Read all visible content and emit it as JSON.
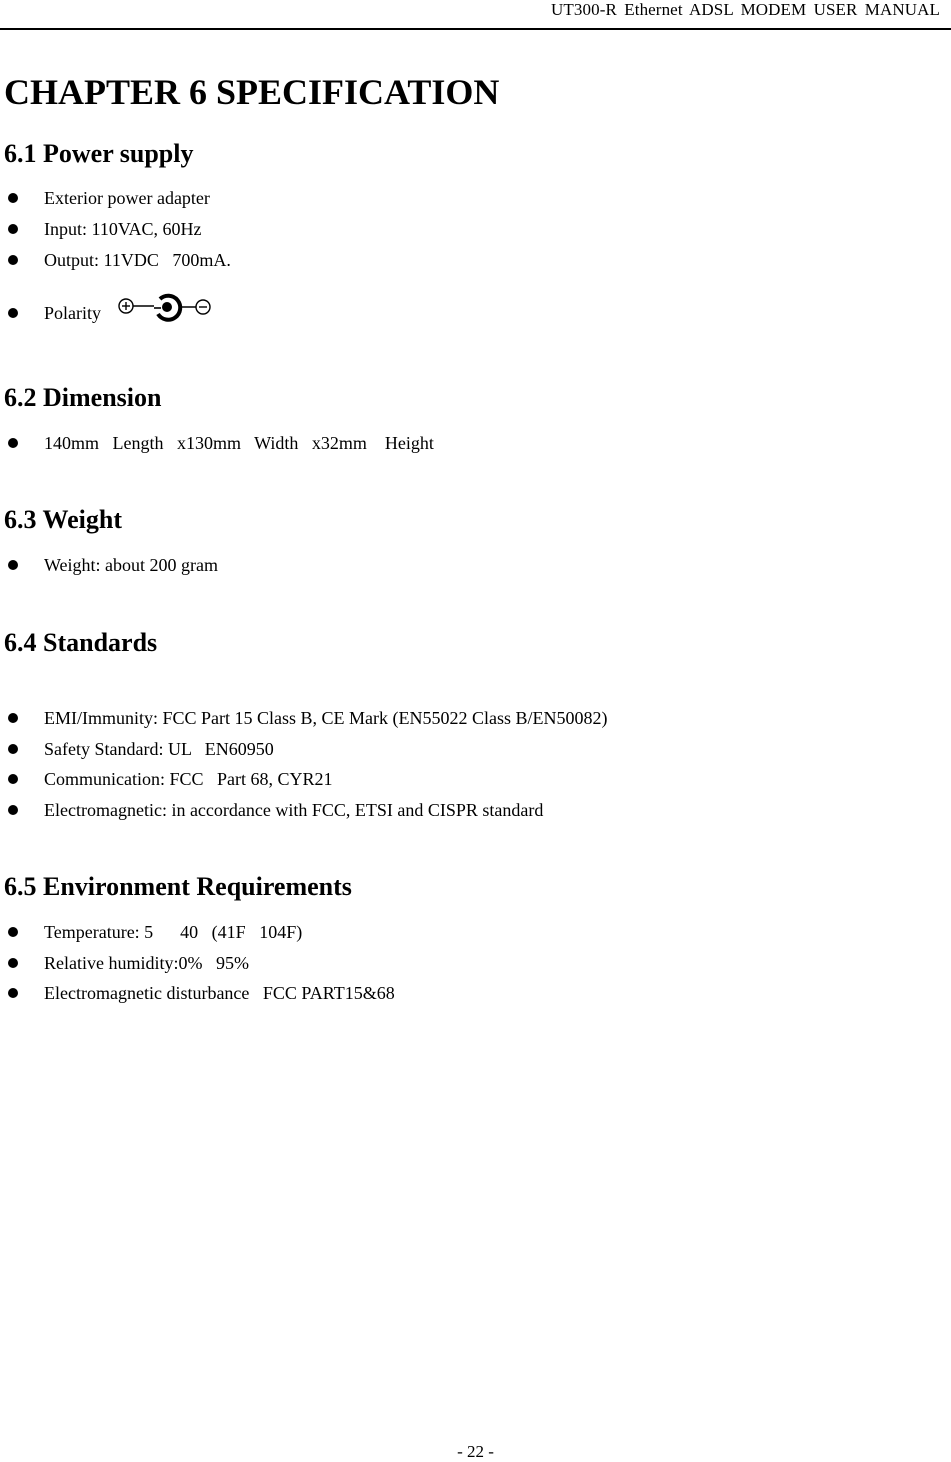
{
  "header": {
    "title": "UT300-R  Ethernet  ADSL  MODEM  USER  MANUAL"
  },
  "chapter": {
    "title": "CHAPTER 6 SPECIFICATION"
  },
  "sections": [
    {
      "title": "6.1 Power supply",
      "items": [
        "Exterior power adapter",
        "Input: 110VAC, 60Hz",
        "Output: 11VDC   700mA.",
        "Polarity"
      ],
      "icons": {
        "polarity": "center-positive-polarity-icon"
      }
    },
    {
      "title": "6.2 Dimension",
      "items": [
        "140mm   Length   x130mm   Width   x32mm    Height"
      ]
    },
    {
      "title": "6.3 Weight",
      "items": [
        "Weight: about 200 gram"
      ]
    },
    {
      "title": "6.4 Standards",
      "items": [
        "EMI/Immunity: FCC Part 15 Class B, CE Mark (EN55022 Class B/EN50082)",
        "Safety Standard: UL   EN60950",
        "Communication: FCC   Part 68, CYR21",
        "Electromagnetic: in accordance with FCC, ETSI and CISPR standard"
      ]
    },
    {
      "title": "6.5 Environment Requirements",
      "items": [
        "Temperature: 5      40   (41F   104F)",
        "Relative humidity:0%   95%",
        "Electromagnetic disturbance   FCC PART15&68"
      ]
    }
  ],
  "footer": {
    "page_number": "- 22 -"
  }
}
